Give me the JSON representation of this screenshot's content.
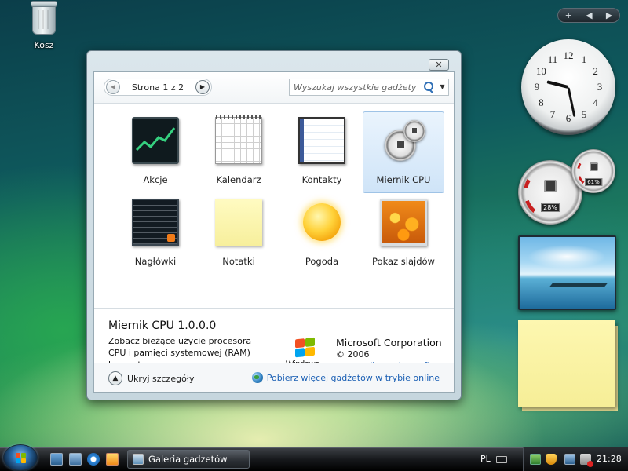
{
  "desktop": {
    "recycle_bin_label": "Kosz"
  },
  "sidebar": {
    "add_label": "+",
    "prev_label": "◀",
    "next_label": "▶"
  },
  "clock_gadget": {
    "numbers": [
      "12",
      "1",
      "2",
      "3",
      "4",
      "5",
      "6",
      "7",
      "8",
      "9",
      "10",
      "11"
    ],
    "time": "21:28"
  },
  "cpu_gadget": {
    "cpu_percent": "28%",
    "ram_percent": "61%"
  },
  "gallery": {
    "close_label": "✕",
    "pager": {
      "label": "Strona 1 z 2",
      "prev_icon": "◀",
      "next_icon": "▶"
    },
    "search": {
      "placeholder": "Wyszukaj wszystkie gadżety",
      "dropdown_icon": "▼"
    },
    "tiles": [
      {
        "label": "Akcje",
        "icon": "stocks-icon"
      },
      {
        "label": "Kalendarz",
        "icon": "calendar-icon"
      },
      {
        "label": "Kontakty",
        "icon": "contacts-icon"
      },
      {
        "label": "Miernik CPU",
        "icon": "cpu-meter-icon",
        "selected": true
      },
      {
        "label": "Nagłówki",
        "icon": "headlines-icon"
      },
      {
        "label": "Notatki",
        "icon": "notes-icon"
      },
      {
        "label": "Pogoda",
        "icon": "weather-icon"
      },
      {
        "label": "Pokaz slajdów",
        "icon": "slideshow-icon"
      }
    ],
    "details": {
      "name": "Miernik CPU 1.0.0.0",
      "description": "Zobacz bieżące użycie procesora CPU i pamięci systemowej (RAM) komputera.",
      "logo_text": "Windows",
      "publisher": "Microsoft Corporation",
      "copyright": "© 2006",
      "url": "www.gallery.microsoft.com"
    },
    "footer": {
      "hide_details_label": "Ukryj szczegóły",
      "hide_icon": "▲",
      "get_more_label": "Pobierz więcej gadżetów w trybie online"
    }
  },
  "taskbar": {
    "active_window_label": "Galeria gadżetów",
    "language": "PL",
    "time": "21:28"
  }
}
